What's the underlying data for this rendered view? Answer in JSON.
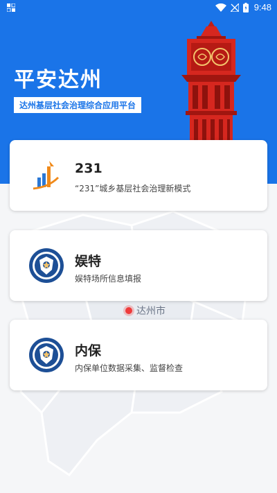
{
  "status_bar": {
    "time": "9:48"
  },
  "header": {
    "title": "平安达州",
    "subtitle": "达州基层社会治理综合应用平台"
  },
  "map": {
    "city_label": "达州市"
  },
  "cards": [
    {
      "title": "231",
      "description": "“231”城乡基层社会治理新模式",
      "icon": "rising-bars-logo-icon"
    },
    {
      "title": "娱特",
      "description": "娱特场所信息填报",
      "icon": "police-emblem-icon"
    },
    {
      "title": "内保",
      "description": "内保单位数据采集、监督检查",
      "icon": "police-emblem-icon"
    }
  ],
  "colors": {
    "brand_blue": "#1a74e8",
    "tower_red": "#d6271f",
    "marker_red": "#ef3b3b"
  }
}
